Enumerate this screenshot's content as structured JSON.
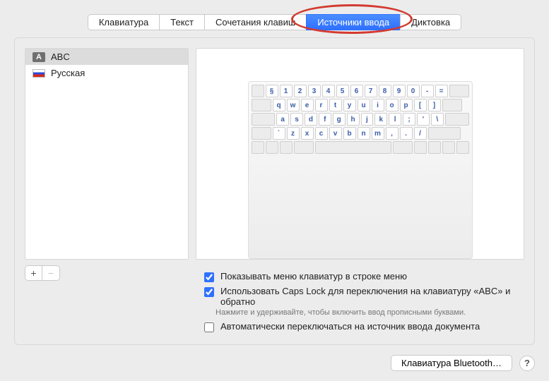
{
  "tabs": {
    "keyboard": "Клавиатура",
    "text": "Текст",
    "shortcuts": "Сочетания клавиш",
    "input_sources": "Источники ввода",
    "dictation": "Диктовка"
  },
  "sources": [
    {
      "id": "abc",
      "label": "ABC",
      "selected": true
    },
    {
      "id": "ru",
      "label": "Русская",
      "selected": false
    }
  ],
  "addremove": {
    "add": "+",
    "remove": "−"
  },
  "options": {
    "show_menu": {
      "label": "Показывать меню клавиатур в строке меню",
      "checked": true
    },
    "caps_lock": {
      "label": "Использовать Caps Lock для переключения на клавиатуру «ABC» и обратно",
      "checked": true
    },
    "caps_lock_hint": "Нажмите и удерживайте, чтобы включить ввод прописными буквами.",
    "auto_switch": {
      "label": "Автоматически переключаться на источник ввода документа",
      "checked": false
    }
  },
  "bottom": {
    "bluetooth": "Клавиатура Bluetooth…",
    "help": "?"
  },
  "keyboard_preview": {
    "row1": [
      "§",
      "1",
      "2",
      "3",
      "4",
      "5",
      "6",
      "7",
      "8",
      "9",
      "0",
      "-",
      "="
    ],
    "row2": [
      "q",
      "w",
      "e",
      "r",
      "t",
      "y",
      "u",
      "i",
      "o",
      "p",
      "[",
      "]"
    ],
    "row3": [
      "a",
      "s",
      "d",
      "f",
      "g",
      "h",
      "j",
      "k",
      "l",
      ";",
      "'",
      "\\"
    ],
    "row4": [
      "`",
      "z",
      "x",
      "c",
      "v",
      "b",
      "n",
      "m",
      ",",
      ".",
      "/"
    ]
  }
}
